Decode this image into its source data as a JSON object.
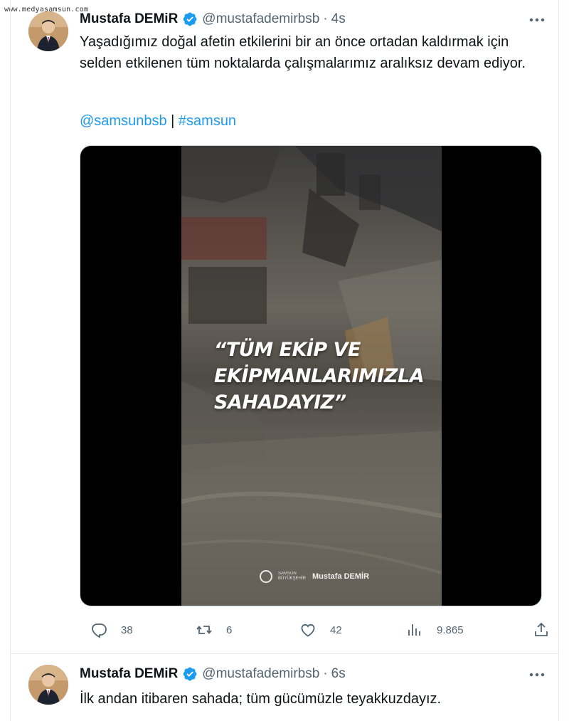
{
  "watermark": "www.medyasamsun.com",
  "tweets": [
    {
      "name": "Mustafa DEMiR",
      "handle": "@mustafademirbsb",
      "separator": "·",
      "time": "4s",
      "text": "Yaşadığımız doğal afetin etkilerini bir an önce ortadan kaldırmak için selden etkilenen tüm noktalarda çalışmalarımız aralıksız devam ediyor.",
      "mention": "@samsunbsb",
      "link_separator": "|",
      "hashtag": "#samsun",
      "media": {
        "overlay_text": "“TÜM EKİP VE EKİPMANLARIMIZLA SAHADAYIZ”",
        "logo_small": "SAMSUN BÜYÜKŞEHİR",
        "logo_name": "Mustafa DEMİR"
      },
      "stats": {
        "replies": "38",
        "retweets": "6",
        "likes": "42",
        "views": "9.865"
      }
    },
    {
      "name": "Mustafa DEMiR",
      "handle": "@mustafademirbsb",
      "separator": "·",
      "time": "6s",
      "text": "İlk andan itibaren sahada; tüm gücümüzle teyakkuzdayız."
    }
  ],
  "colors": {
    "link": "#1d9bf0",
    "secondary_text": "#536471",
    "verified": "#1d9bf0"
  },
  "icons": [
    "verified-badge-icon",
    "more-icon",
    "reply-icon",
    "retweet-icon",
    "like-icon",
    "views-icon",
    "share-icon"
  ]
}
